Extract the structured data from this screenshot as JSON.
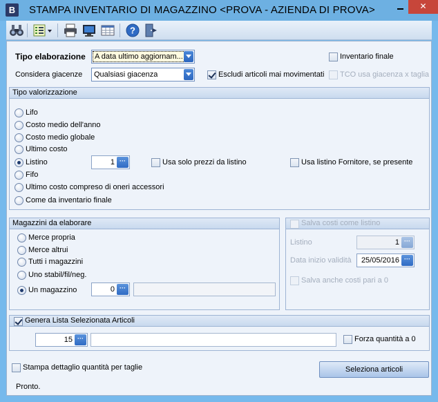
{
  "window": {
    "title": "STAMPA INVENTARIO DI MAGAZZINO <PROVA - AZIENDA DI PROVA>",
    "app_icon": "B",
    "close": "✕"
  },
  "toolbar": {
    "icons": [
      "binoculars-icon",
      "list-options-icon",
      "printer-icon",
      "monitor-preview-icon",
      "grid-icon",
      "help-icon",
      "exit-icon"
    ]
  },
  "top": {
    "tipo_elaborazione_label": "Tipo elaborazione",
    "tipo_elaborazione_value": "A data ultimo aggiornam...",
    "considera_giacenze_label": "Considera giacenze",
    "considera_giacenze_value": "Qualsiasi giacenza",
    "inventario_finale": "Inventario finale",
    "escludi_articoli": "Escludi articoli mai movimentati",
    "tco_giacenza": "TCO usa giacenza x taglia"
  },
  "valorizzazione": {
    "title": "Tipo valorizzazione",
    "options": [
      "Lifo",
      "Costo medio dell'anno",
      "Costo medio globale",
      "Ultimo costo",
      "Listino",
      "Fifo",
      "Ultimo costo compreso di oneri accessori",
      "Come da inventario finale"
    ],
    "selected": "Listino",
    "listino_value": "1",
    "usa_solo_prezzi": "Usa solo prezzi da listino",
    "usa_listino_fornitore": "Usa listino Fornitore, se presente"
  },
  "magazzini": {
    "title": "Magazzini da elaborare",
    "options": [
      "Merce propria",
      "Merce altrui",
      "Tutti i magazzini",
      "Uno stabil/fil/neg.",
      "Un magazzino"
    ],
    "selected": "Un magazzino",
    "magazzino_value": "0"
  },
  "salva_costi": {
    "title": "Salva costi come listino",
    "listino_label": "Listino",
    "listino_value": "1",
    "data_label": "Data inizio validità",
    "data_value": "25/05/2016",
    "salva_anche": "Salva anche costi pari a 0"
  },
  "genera_lista": {
    "title": "Genera Lista Selezionata Articoli",
    "value": "15",
    "forza_quantita": "Forza quantità a 0"
  },
  "bottom": {
    "stampa_dettaglio": "Stampa dettaglio quantità per taglie",
    "seleziona_articoli": "Seleziona articoli",
    "status": "Pronto."
  },
  "colors": {
    "titlebar": "#6db0e2",
    "close": "#c7463a",
    "panel": "#eef3fa",
    "accent": "#2f6bc4"
  }
}
